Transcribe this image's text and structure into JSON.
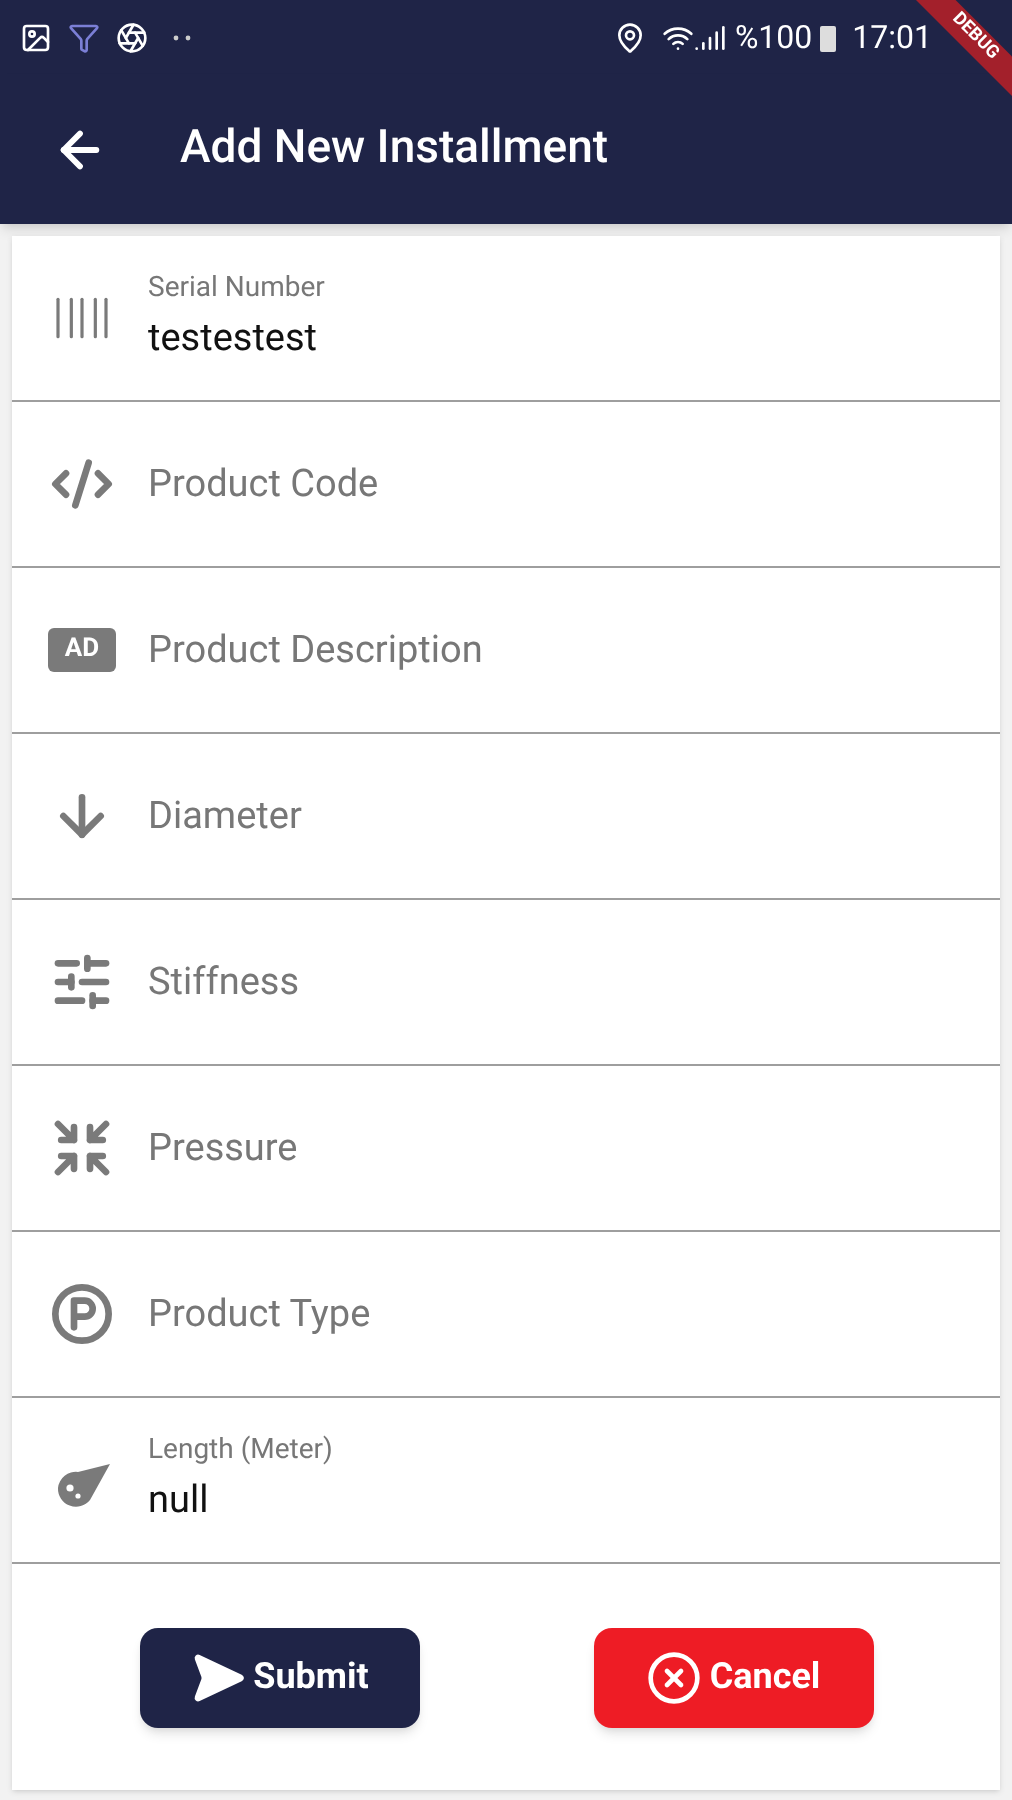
{
  "status_bar": {
    "battery": "%100",
    "time": "17:01"
  },
  "debug_banner": "DEBUG",
  "app_bar": {
    "title": "Add New Installment"
  },
  "fields": [
    {
      "kind": "filled",
      "label": "Serial Number",
      "value": "testestest"
    },
    {
      "kind": "empty",
      "placeholder": "Product Code"
    },
    {
      "kind": "empty",
      "placeholder": "Product Description",
      "icon_text": "AD"
    },
    {
      "kind": "empty",
      "placeholder": "Diameter"
    },
    {
      "kind": "empty",
      "placeholder": "Stiffness"
    },
    {
      "kind": "empty",
      "placeholder": "Pressure"
    },
    {
      "kind": "empty",
      "placeholder": "Product Type"
    },
    {
      "kind": "filled",
      "label": "Length (Meter)",
      "value": "null"
    }
  ],
  "buttons": [
    {
      "kind": "submit",
      "label": "Submit"
    },
    {
      "kind": "cancel",
      "label": "Cancel"
    }
  ]
}
